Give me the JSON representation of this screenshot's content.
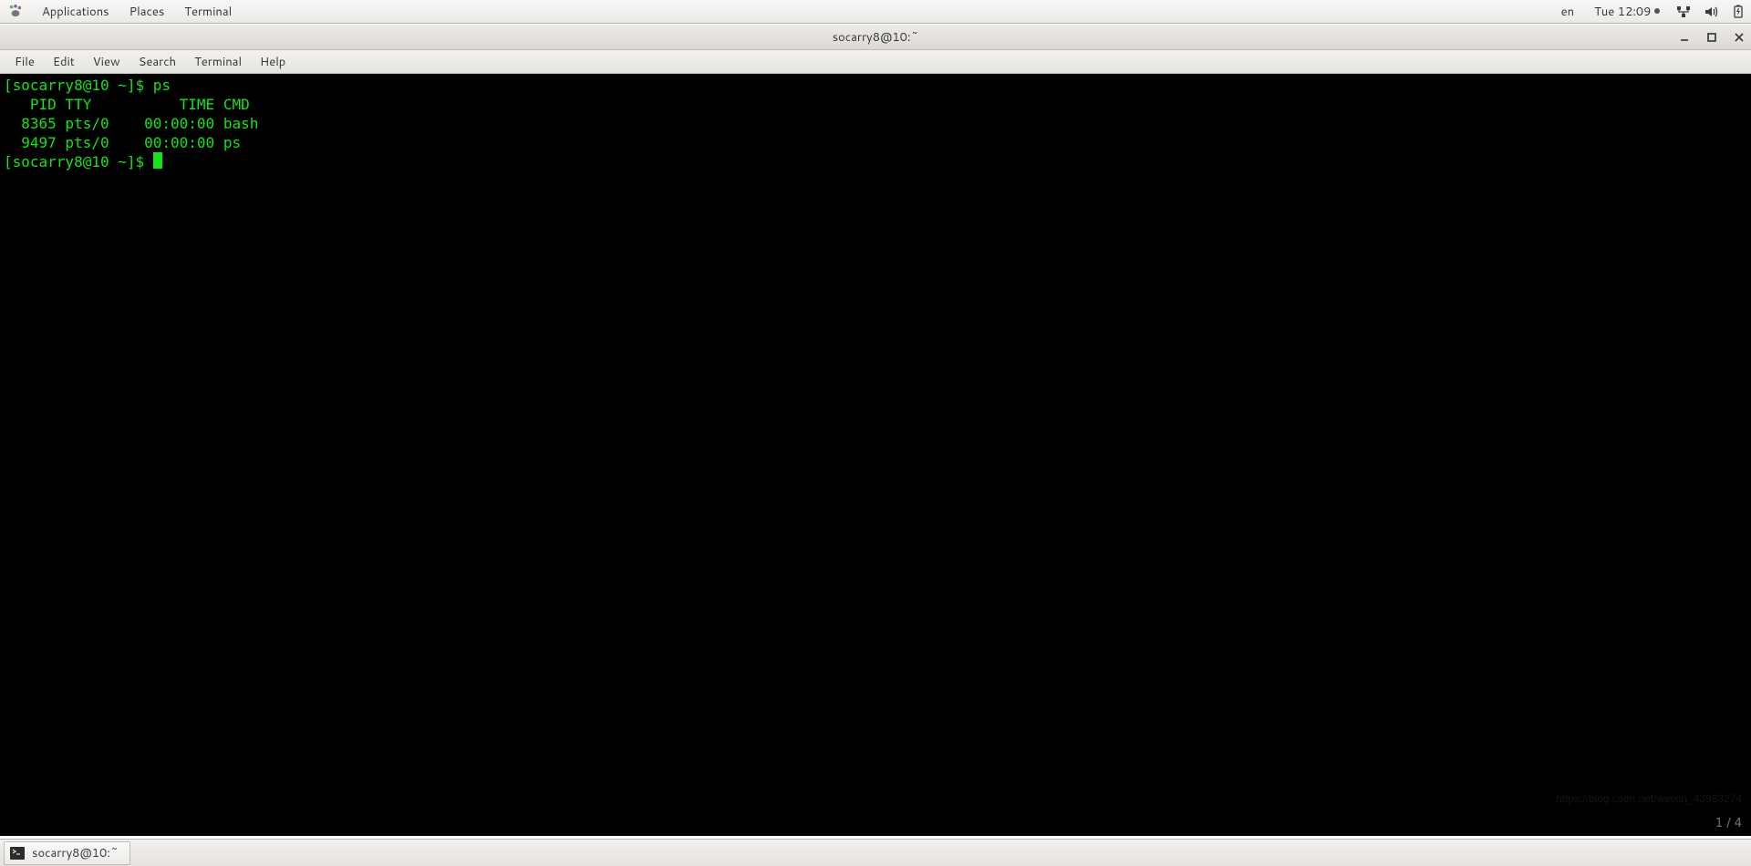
{
  "top_panel": {
    "applications": "Applications",
    "places": "Places",
    "active_app": "Terminal",
    "lang": "en",
    "clock": "Tue 12:09"
  },
  "window": {
    "title": "socarry8@10:~"
  },
  "menubar": {
    "file": "File",
    "edit": "Edit",
    "view": "View",
    "search": "Search",
    "terminal": "Terminal",
    "help": "Help"
  },
  "terminal": {
    "prompt1": "[socarry8@10 ~]$ ",
    "cmd1": "ps",
    "header": "   PID TTY          TIME CMD",
    "row1": "  8365 pts/0    00:00:00 bash",
    "row2": "  9497 pts/0    00:00:00 ps",
    "prompt2": "[socarry8@10 ~]$ "
  },
  "taskbar": {
    "entry": "socarry8@10:~"
  },
  "page_indicator": "1 / 4",
  "watermark": "https://blog.csdn.net/weixin_43983274"
}
